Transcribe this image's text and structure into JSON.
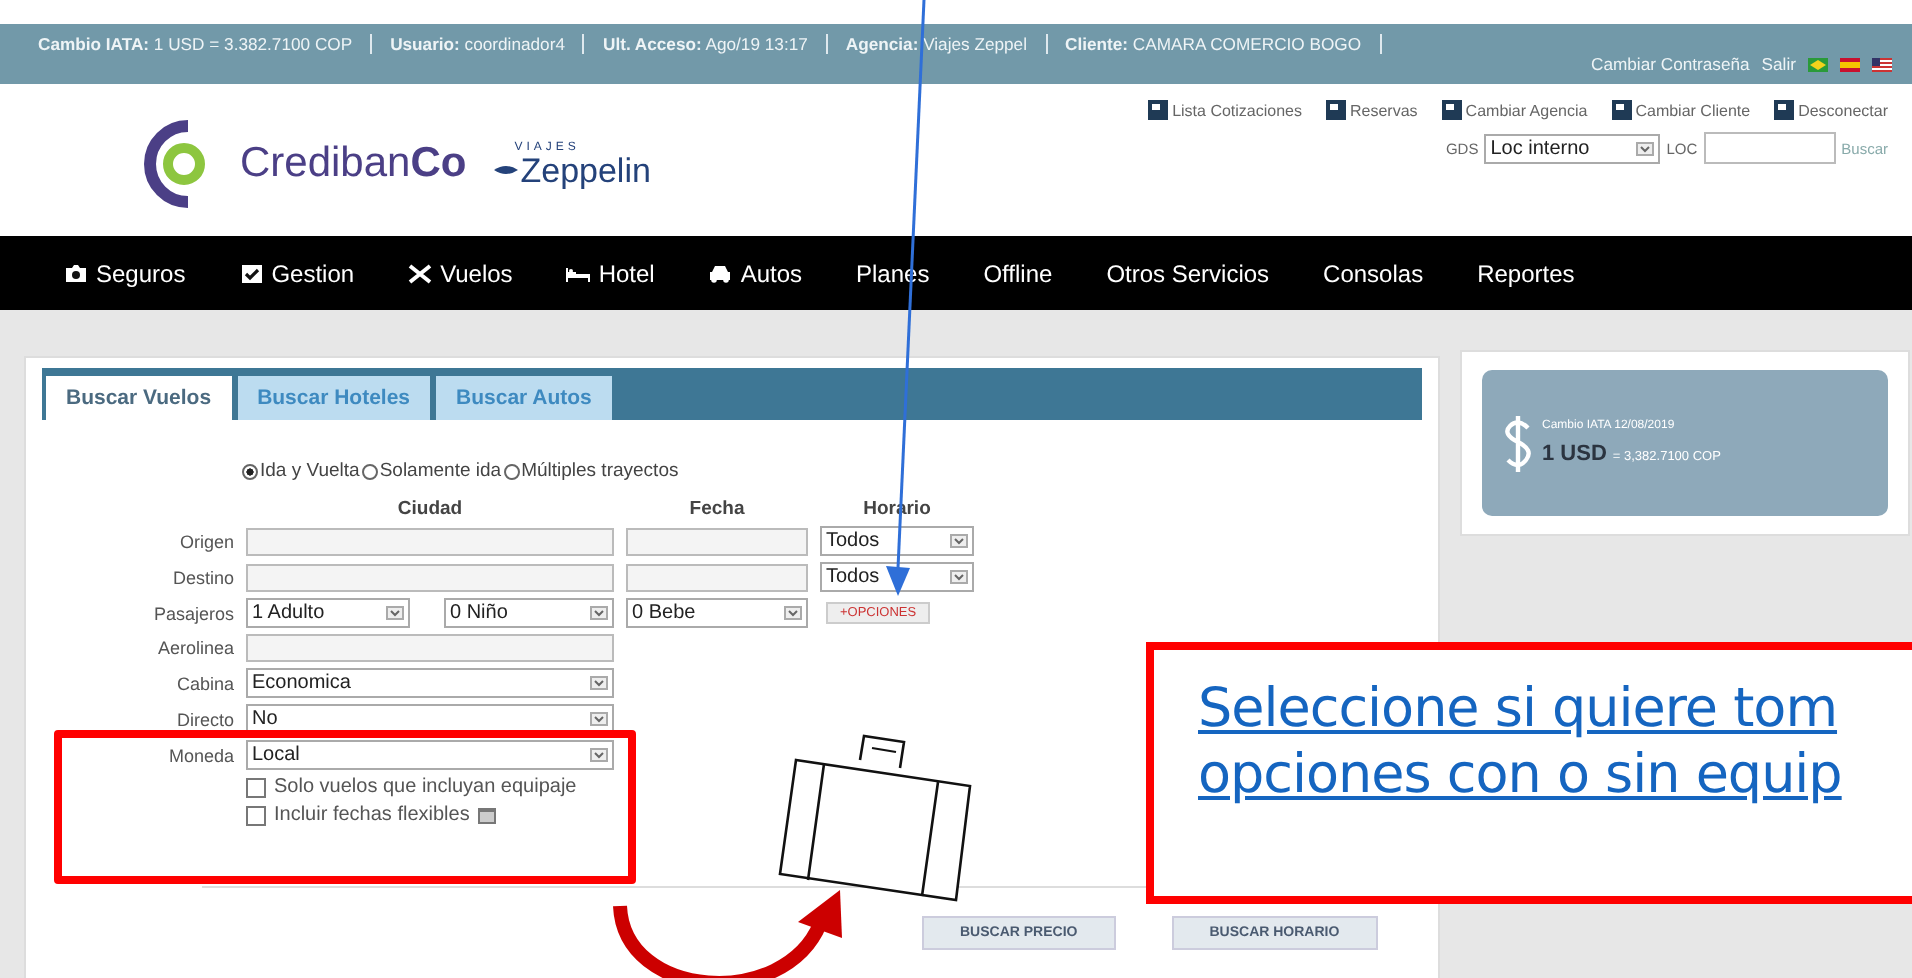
{
  "info_bar": {
    "items": [
      "**Cambio IATA:** 1 USD = 3.382.7100 COP",
      "**Usuario:** coordinador4",
      "**Ult. Acceso:** Ago/19 13:17",
      "**Agencia:** Viajes Zeppel",
      "**Cliente:** CAMARA COMERCIO BOGO"
    ],
    "links": [
      "Cambiar Contraseña",
      "Salir"
    ]
  },
  "header": {
    "brand": "Crediban**Co**",
    "partner_top": "VIAJES",
    "partner": "Zeppelin",
    "links": [
      "Lista Cotizaciones",
      "Reservas",
      "Cambiar Agencia",
      "Cambiar Cliente",
      "Desconectar"
    ],
    "gds_label": "GDS",
    "gds_value": "Loc interno",
    "loc_label": "LOC",
    "search": "Buscar"
  },
  "nav": [
    "Seguros",
    "Gestion",
    "Vuelos",
    "Hotel",
    "Autos",
    "Planes",
    "Offline",
    "Otros Servicios",
    "Consolas",
    "Reportes"
  ],
  "tabs": [
    {
      "label": "Buscar Vuelos",
      "selected": true
    },
    {
      "label": "Buscar Hoteles",
      "selected": false
    },
    {
      "label": "Buscar Autos",
      "selected": false
    }
  ],
  "trip_type": [
    {
      "label": "Ida y Vuelta",
      "selected": true
    },
    {
      "label": "Solamente ida",
      "selected": false
    },
    {
      "label": "Múltiples trayectos",
      "selected": false
    }
  ],
  "columns": [
    "Ciudad",
    "Fecha",
    "Horario"
  ],
  "route_rows": [
    {
      "label": "Origen",
      "horario": "Todos"
    },
    {
      "label": "Destino",
      "horario": "Todos"
    }
  ],
  "passengers": {
    "label": "Pasajeros",
    "adults": "1 Adulto",
    "children": "0 Niño",
    "infants": "0 Bebe",
    "options": "+OPCIONES"
  },
  "airline": {
    "label": "Aerolinea"
  },
  "selects": [
    {
      "label": "Cabina",
      "value": "Economica"
    },
    {
      "label": "Directo",
      "value": "No"
    },
    {
      "label": "Moneda",
      "value": "Local"
    }
  ],
  "checkboxes": [
    {
      "label": "Solo vuelos que incluyan equipaje",
      "checked": false
    },
    {
      "label": "Incluir fechas flexibles",
      "checked": false
    }
  ],
  "buttons": [
    "BUSCAR PRECIO",
    "BUSCAR HORARIO"
  ],
  "rate_card": {
    "title": "Cambio IATA 12/08/2019",
    "amount": "1 USD",
    "value": "= 3,382.7100 COP"
  },
  "callout": {
    "lines": [
      "Seleccione si quiere tom",
      "opciones con o sin equip"
    ]
  }
}
